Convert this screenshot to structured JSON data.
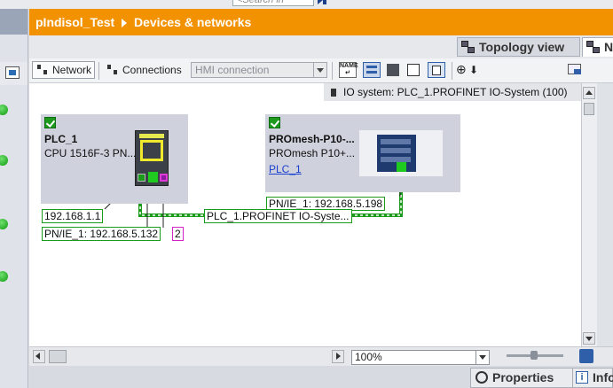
{
  "search": {
    "placeholder": "<Search in project>"
  },
  "title_bar": {
    "project": "pIndisol_Test",
    "section": "Devices & networks"
  },
  "view_tabs": {
    "topology": "Topology view",
    "network_partial": "N"
  },
  "toolbar": {
    "network_label": "Network",
    "connections_label": "Connections",
    "connection_type": "HMI connection"
  },
  "io_system": {
    "label": "IO system: PLC_1.PROFINET IO-System (100)"
  },
  "devices": [
    {
      "name": "PLC_1",
      "type": "CPU 1516F-3 PN...",
      "status": "ok"
    },
    {
      "name": "PROmesh-P10-...",
      "type": "PROmesh P10+...",
      "link": "PLC_1",
      "status": "ok"
    }
  ],
  "labels": {
    "plc_ip": "192.168.1.1",
    "plc_pn": "PN/IE_1:  192.168.5.132",
    "plc_pn_count": "2",
    "switch_pn": "PN/IE_1:  192.168.5.198",
    "network": "PLC_1.PROFINET IO-Syste..."
  },
  "zoom": {
    "value": "100%"
  },
  "bottom_tabs": {
    "properties": "Properties",
    "info_partial": "Info"
  },
  "colors": {
    "accent": "#f39200",
    "network_line": "#1b9a1b",
    "status_ok": "#1d9a1d",
    "link": "#1a3fd0"
  },
  "icons": [
    "search-go-icon",
    "topology-icon",
    "network-icon",
    "connections-icon",
    "zoom-icon",
    "properties-icon",
    "info-icon"
  ]
}
